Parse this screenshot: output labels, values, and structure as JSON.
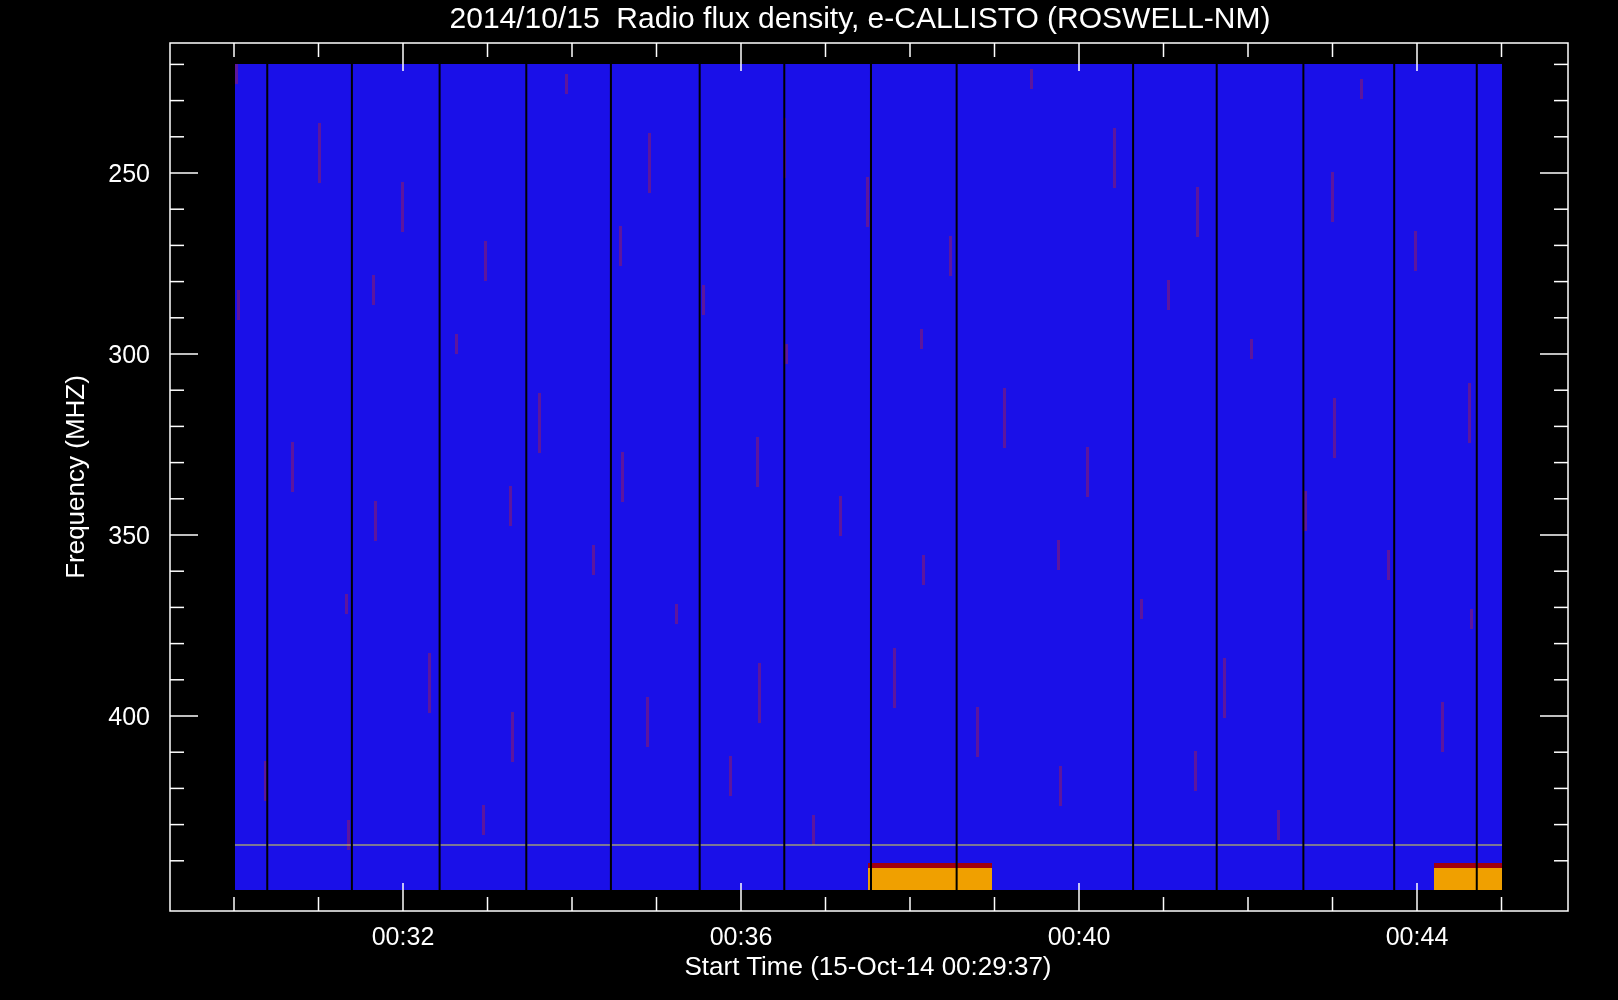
{
  "plot": {
    "title": "2014/10/15  Radio flux density, e-CALLISTO (ROSWELL-NM)",
    "y_axis": {
      "label": "Frequency (MHZ)",
      "ticks": [
        "250",
        "300",
        "350",
        "400"
      ]
    },
    "x_axis": {
      "label": "Start Time (15-Oct-14 00:29:37)",
      "ticks": [
        "00:32",
        "00:36",
        "00:40",
        "00:44"
      ]
    }
  }
}
